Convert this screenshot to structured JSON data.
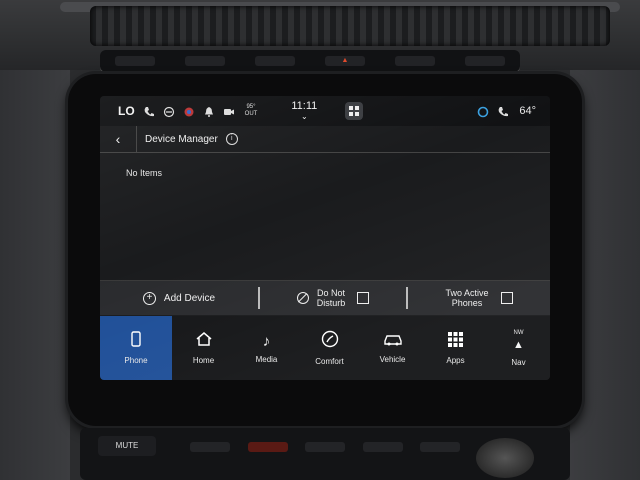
{
  "status": {
    "mode": "LO",
    "outside_temp": "95°",
    "outside_label": "OUT",
    "clock": "11:11",
    "cabin_temp": "64°"
  },
  "header": {
    "title": "Device Manager"
  },
  "content": {
    "empty_text": "No Items"
  },
  "actions": {
    "add_device": "Add Device",
    "dnd_line1": "Do Not",
    "dnd_line2": "Disturb",
    "two_phones_line1": "Two Active",
    "two_phones_line2": "Phones"
  },
  "nav": {
    "phone": "Phone",
    "home": "Home",
    "media": "Media",
    "comfort": "Comfort",
    "vehicle": "Vehicle",
    "apps": "Apps",
    "nav_heading": "NW",
    "nav": "Nav"
  },
  "console": {
    "mute": "MUTE"
  },
  "colors": {
    "active_tab": "#1f4f98",
    "screen_bg": "#1a1b1d"
  }
}
